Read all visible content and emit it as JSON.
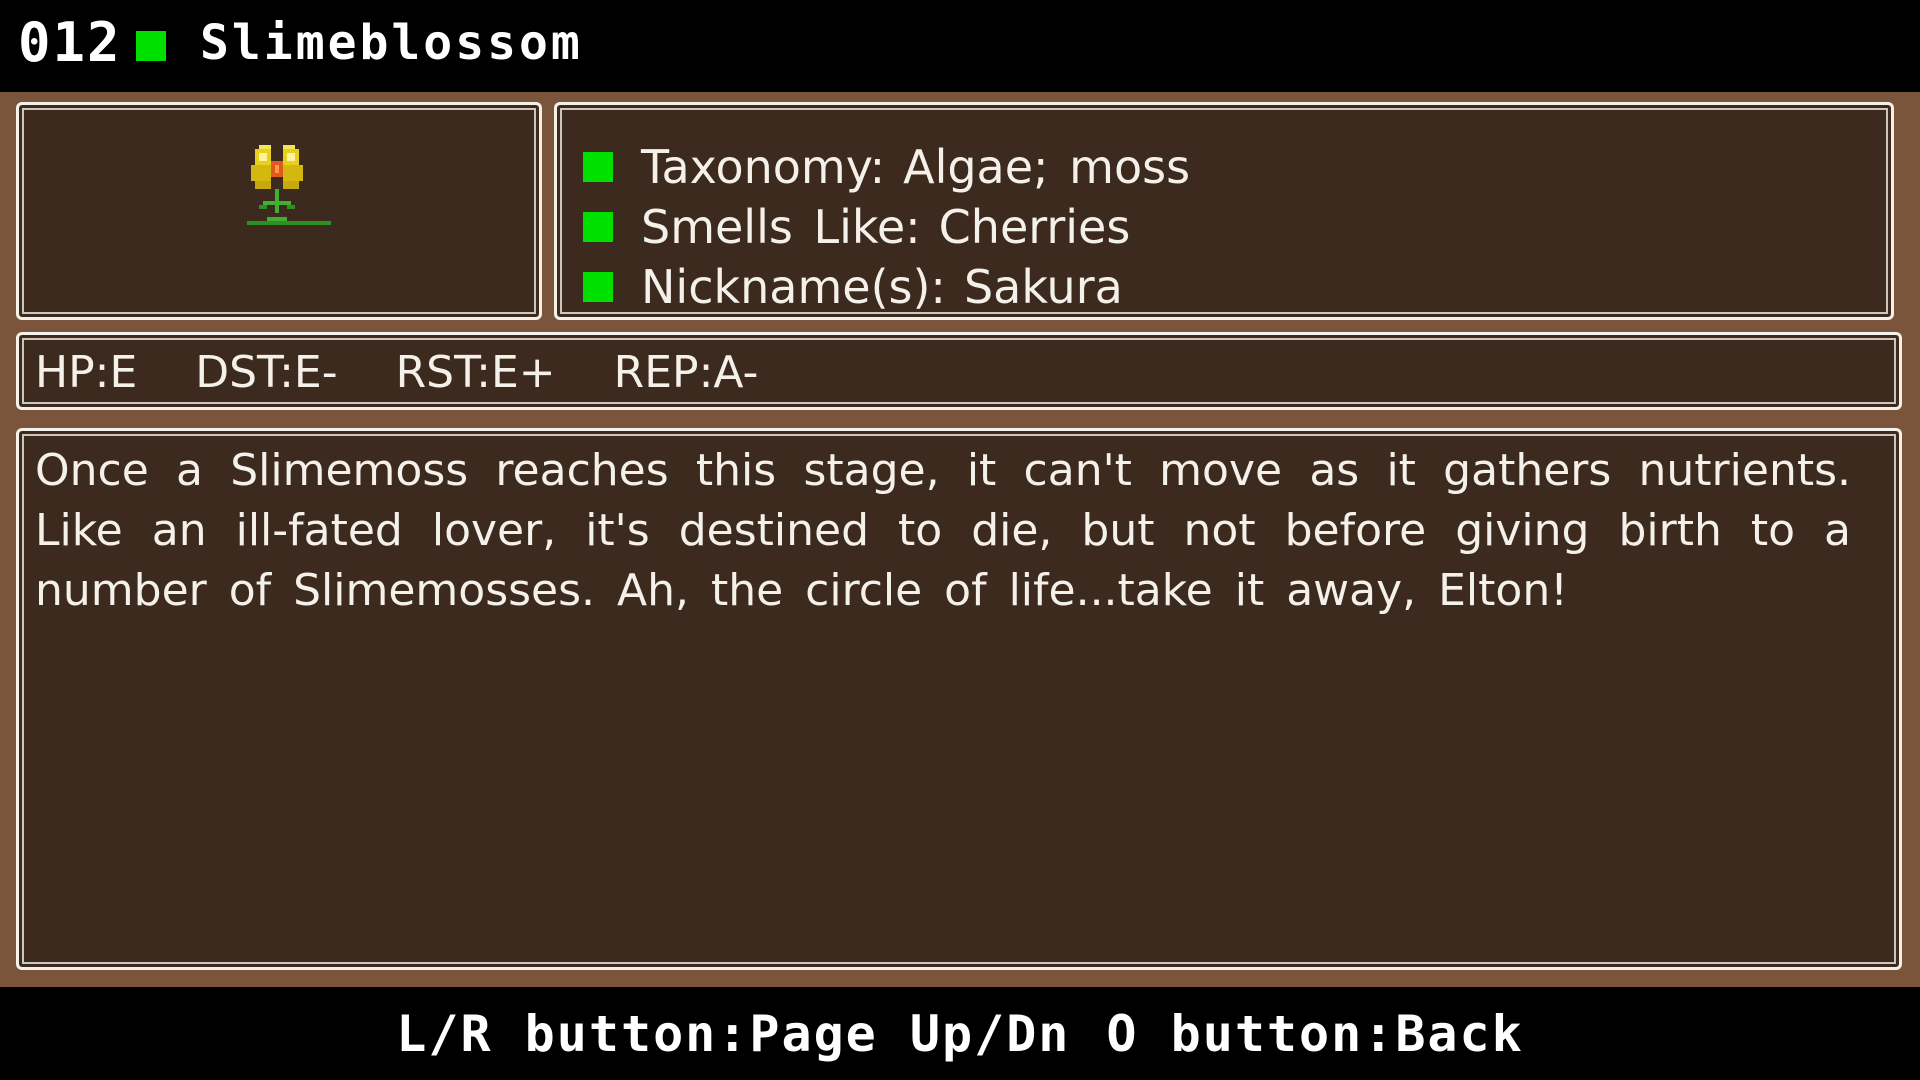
{
  "header": {
    "entry_number": "012",
    "entry_name": "Slimeblossom"
  },
  "portrait": {
    "icon": "yellow-flower-icon"
  },
  "info": {
    "rows": [
      {
        "label": "Taxonomy:",
        "value": "Algae; moss"
      },
      {
        "label": "Smells Like:",
        "value": "Cherries"
      },
      {
        "label": "Nickname(s):",
        "value": "Sakura"
      }
    ]
  },
  "stats": {
    "hp": "HP:E",
    "dst": "DST:E-",
    "rst": "RST:E+",
    "rep": "REP:A-"
  },
  "description": {
    "text": "Once a Slimemoss reaches this stage, it can't move as it gathers nutrients. Like an ill-fated lover, it's destined to die, but not before giving birth to a number of Slimemosses. Ah, the circle of life...take it away, Elton!"
  },
  "controls": {
    "page_hint": "L/R button:Page Up/Dn",
    "back_hint": "O button:Back"
  },
  "colors": {
    "accent": "#00e000",
    "frame": "#7a543b",
    "panel": "#3d2a1e",
    "text": "#f4f0ea"
  }
}
